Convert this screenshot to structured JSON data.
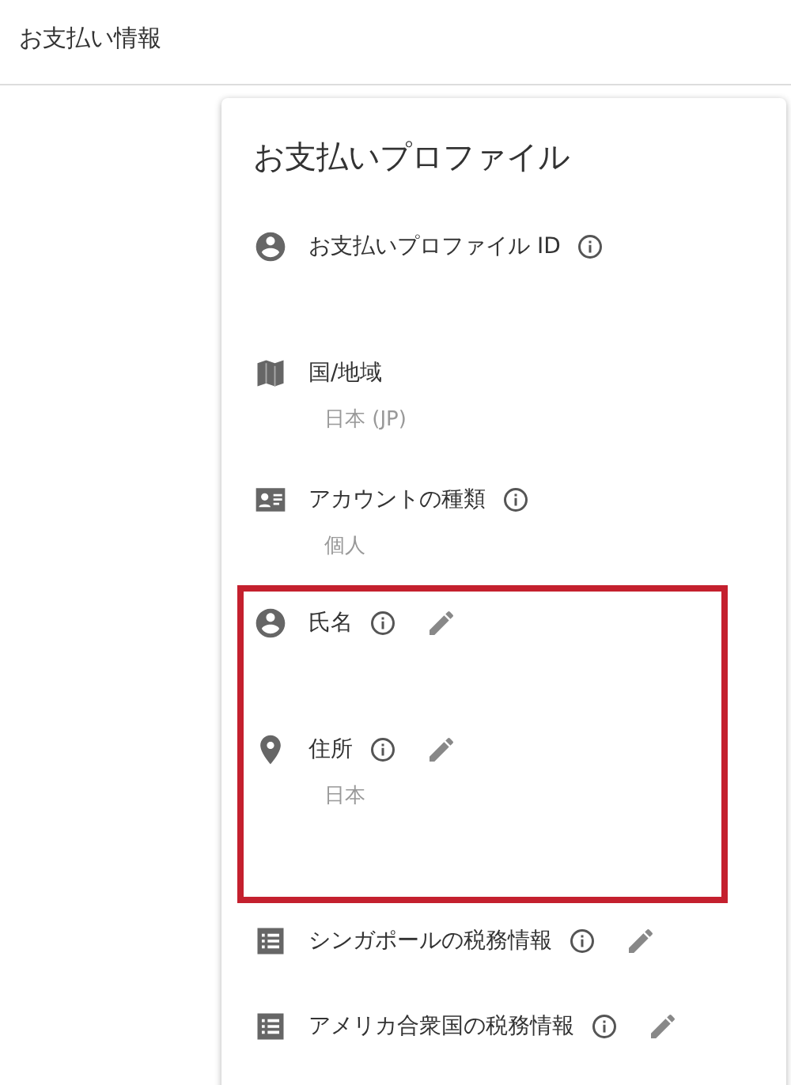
{
  "header": {
    "title": "お支払い情報"
  },
  "card": {
    "title": "お支払いプロファイル",
    "rows": [
      {
        "kind": "account",
        "label": "お支払いプロファイル ID",
        "info": true,
        "editable": false,
        "highlighted": false
      },
      {
        "kind": "map",
        "label": "国/地域",
        "value": "日本 (JP)",
        "info": false,
        "editable": false,
        "highlighted": false
      },
      {
        "kind": "idcard",
        "label": "アカウントの種類",
        "value": "個人",
        "info": true,
        "editable": false,
        "highlighted": false
      },
      {
        "kind": "account",
        "label": "氏名",
        "info": true,
        "editable": true,
        "highlighted": true
      },
      {
        "kind": "place",
        "label": "住所",
        "value": "日本",
        "info": true,
        "editable": true,
        "highlighted": true
      },
      {
        "kind": "list",
        "label": "シンガポールの税務情報",
        "info": true,
        "editable": true,
        "highlighted": false
      },
      {
        "kind": "list",
        "label": "アメリカ合衆国の税務情報",
        "info": true,
        "editable": true,
        "highlighted": false
      }
    ]
  }
}
